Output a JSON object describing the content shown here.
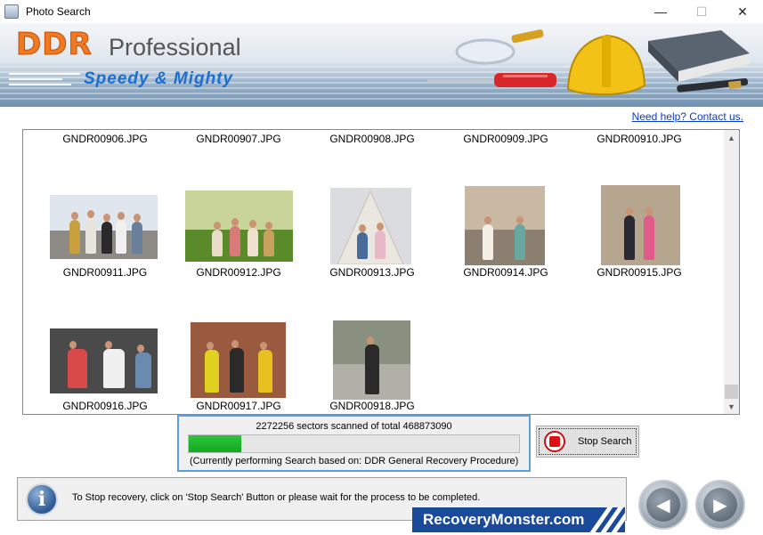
{
  "window": {
    "title": "Photo Search",
    "minimize_glyph": "—",
    "maximize_glyph": "☐",
    "close_glyph": "✕"
  },
  "banner": {
    "brand": "DDR",
    "product": "Professional",
    "tagline": "Speedy & Mighty",
    "icons": [
      "magnifier-icon",
      "screwdriver-icon",
      "hardhat-icon",
      "book-icon",
      "pen-icon"
    ]
  },
  "help_link": "Need help? Contact us.",
  "results": {
    "header_row": [
      "GNDR00906.JPG",
      "GNDR00907.JPG",
      "GNDR00908.JPG",
      "GNDR00909.JPG",
      "GNDR00910.JPG"
    ],
    "rows": [
      [
        "GNDR00911.JPG",
        "GNDR00912.JPG",
        "GNDR00913.JPG",
        "GNDR00914.JPG",
        "GNDR00915.JPG"
      ],
      [
        "GNDR00916.JPG",
        "GNDR00917.JPG",
        "GNDR00918.JPG"
      ]
    ]
  },
  "progress": {
    "sectors_text": "2272256 sectors scanned of total 468873090",
    "fraction": 0.16,
    "method_text": "(Currently performing Search based on:  DDR General Recovery Procedure)"
  },
  "stop_button": "Stop Search",
  "status": {
    "message": "To Stop recovery, click on 'Stop Search' Button or please wait for the process to be completed.",
    "info_glyph": "i"
  },
  "logo": "RecoveryMonster.com",
  "nav": {
    "back_glyph": "◀",
    "next_glyph": "▶"
  },
  "colors": {
    "accent": "#1c6fd0",
    "progress": "#1fb52c",
    "brand": "#f07a23"
  }
}
